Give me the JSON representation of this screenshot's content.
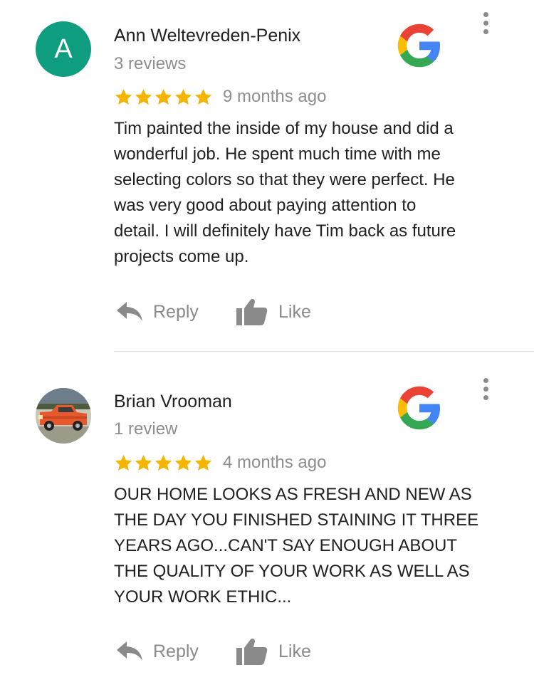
{
  "reviews": [
    {
      "avatar_letter": "A",
      "avatar_color": "#0f9d7f",
      "name": "Ann Weltevreden-Penix",
      "review_count": "3 reviews",
      "rating": 5,
      "time": "9 months ago",
      "text": "Tim painted the inside of my house and did a\nwonderful job.  He spent much time with me\nselecting colors so that they were perfect.  He\nwas very good about paying attention to\ndetail.  I will definitely have Tim back as future\nprojects come up.",
      "reply_label": "Reply",
      "like_label": "Like"
    },
    {
      "avatar_type": "photo",
      "name": "Brian Vrooman",
      "review_count": "1 review",
      "rating": 5,
      "time": "4 months ago",
      "text": "OUR HOME LOOKS AS FRESH AND NEW AS\nTHE DAY YOU FINISHED STAINING IT THREE\nYEARS AGO...CAN'T SAY ENOUGH ABOUT\nTHE QUALITY OF YOUR WORK AS WELL AS\nYOUR WORK ETHIC...",
      "reply_label": "Reply",
      "like_label": "Like"
    }
  ],
  "colors": {
    "star": "#f4b400",
    "secondary_text": "#8e8e8e",
    "icon_gray": "#8a8a8a",
    "google_blue": "#4285F4",
    "google_red": "#EA4335",
    "google_yellow": "#FBBC05",
    "google_green": "#34A853"
  },
  "icons": [
    "google-g-logo",
    "more-vert-icon",
    "star-icon",
    "reply-arrow-icon",
    "thumbs-up-icon"
  ]
}
